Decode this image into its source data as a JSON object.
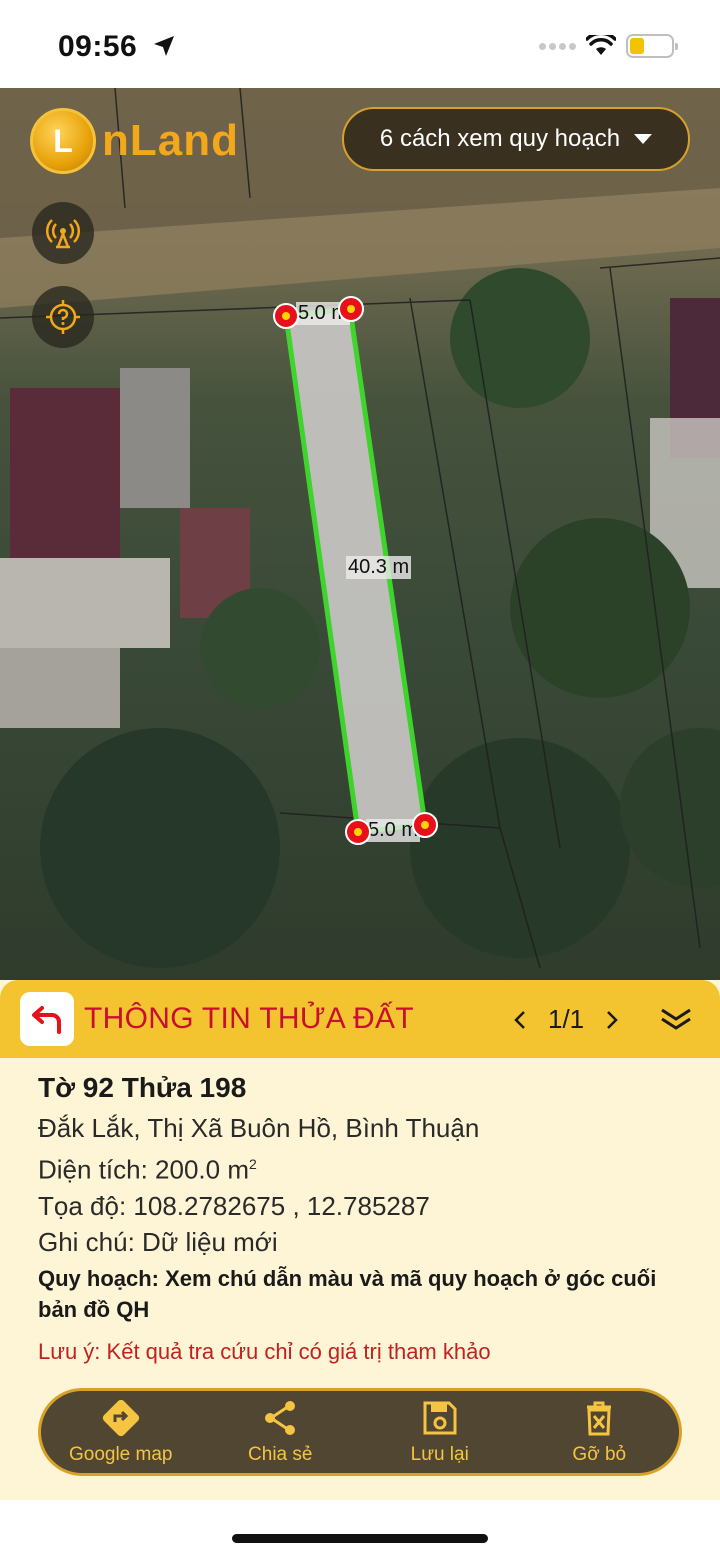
{
  "status_bar": {
    "time": "09:56"
  },
  "map": {
    "logo_letter": "L",
    "logo_text": "nLand",
    "plan_dropdown_label": "6 cách xem quy hoạch",
    "length_label": "40.3 m",
    "top_width_label": "5.0 m",
    "bottom_width_label": "5.0 m"
  },
  "panel": {
    "title": "THÔNG TIN THỬA ĐẤT",
    "pager": "1/1",
    "parcel_heading": "Tờ 92 Thửa 198",
    "address": "Đắk Lắk, Thị Xã Buôn Hồ, Bình Thuận",
    "area": "Diện tích: 200.0 m",
    "area_unit_sup": "2",
    "coordinates": "Tọa độ: 108.2782675 , 12.785287",
    "note": "Ghi chú: Dữ liệu mới",
    "planning": "Quy hoạch: Xem chú dẫn màu và mã quy hoạch ở góc cuối bản đồ QH",
    "disclaimer": "Lưu ý: Kết quả tra cứu chỉ có giá trị tham khảo"
  },
  "actions": [
    {
      "label": "Google map",
      "icon": "directions-icon"
    },
    {
      "label": "Chia sẻ",
      "icon": "share-icon"
    },
    {
      "label": "Lưu lại",
      "icon": "save-icon"
    },
    {
      "label": "Gỡ bỏ",
      "icon": "delete-icon"
    }
  ],
  "colors": {
    "accent": "#f4c430",
    "title_red": "#c8102e",
    "parcel_outline": "#3ee02a",
    "panel_bg": "#fdf5d6",
    "action_bar_bg": "#514632"
  }
}
